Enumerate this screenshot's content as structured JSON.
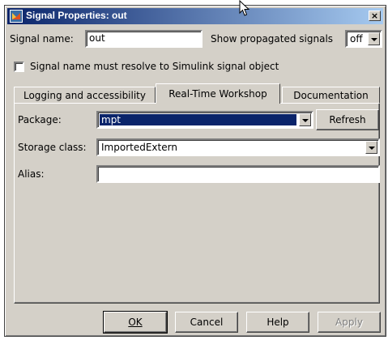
{
  "window": {
    "title": "Signal Properties: out",
    "close_glyph": "×"
  },
  "signal_name": {
    "label": "Signal name:",
    "value": "out"
  },
  "show_propagated": {
    "label": "Show propagated signals",
    "value": "off"
  },
  "resolve_checkbox": {
    "label": "Signal name must resolve to Simulink signal object",
    "checked": false
  },
  "tabs": [
    {
      "label": "Logging and accessibility",
      "active": false
    },
    {
      "label": "Real-Time Workshop",
      "active": true
    },
    {
      "label": "Documentation",
      "active": false
    }
  ],
  "rtw": {
    "package_label": "Package:",
    "package_value": "mpt",
    "refresh_label": "Refresh",
    "storage_label": "Storage class:",
    "storage_value": "ImportedExtern",
    "alias_label": "Alias:",
    "alias_value": ""
  },
  "buttons": {
    "ok": "OK",
    "cancel": "Cancel",
    "help": "Help",
    "apply": "Apply"
  },
  "colors": {
    "dialog_bg": "#d4d0c8",
    "title_start": "#0a246a",
    "title_end": "#a6caf0",
    "selection": "#0a246a"
  }
}
